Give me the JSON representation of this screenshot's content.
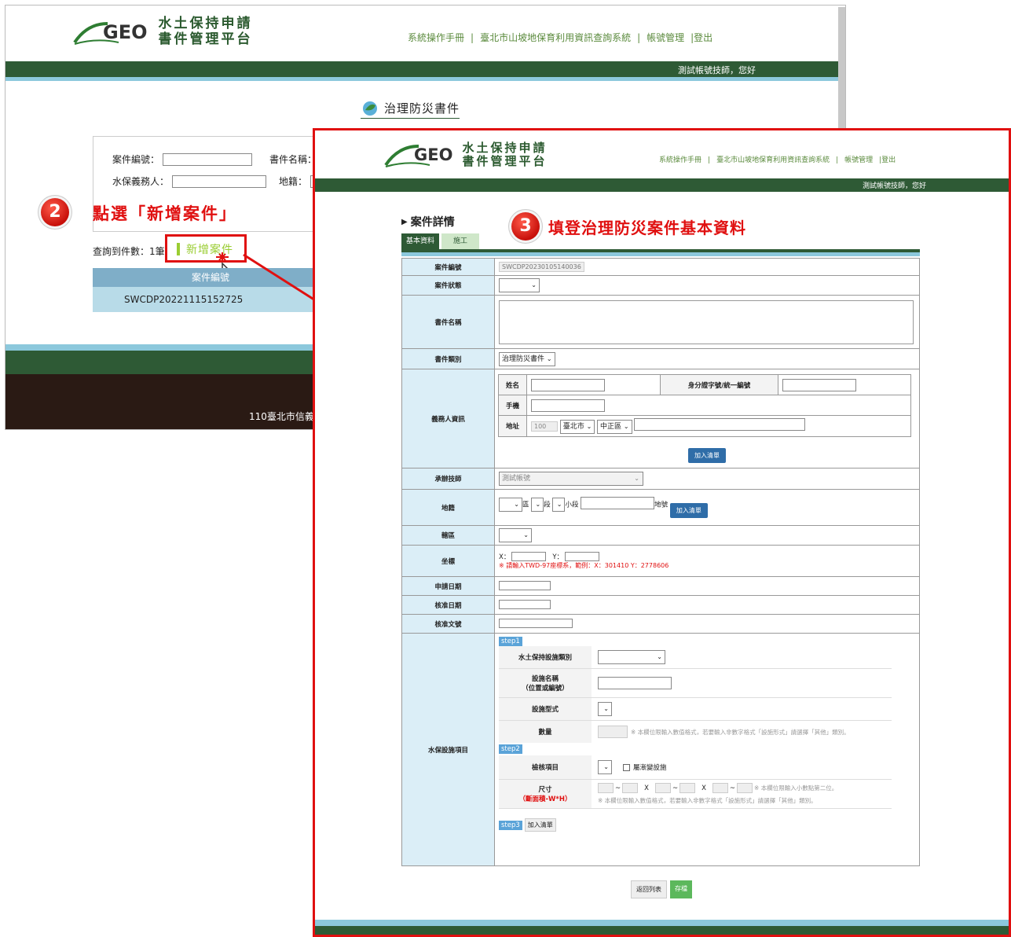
{
  "bg": {
    "logo_geo": "GEO",
    "logo_line1": "水土保持申請",
    "logo_line2": "書件管理平台",
    "nav": [
      "系統操作手冊",
      "|",
      "臺北市山坡地保育利用資訊查詢系統",
      "|",
      "帳號管理",
      "|登出"
    ],
    "greeting": "測試帳號技師，您好",
    "page_title": "治理防災書件",
    "search": {
      "case_no_label": "案件編號：",
      "doc_name_label": "書件名稱：",
      "obligor_label": "水保義務人：",
      "land_label": "地籍："
    },
    "result_count": "查詢到件數：1筆",
    "add_case": "新增案件",
    "table_header": "案件編號",
    "table_row": "SWCDP20221115152725",
    "footer_addr": "110臺北市信義"
  },
  "annotations": {
    "step2_num": "2",
    "step2_text": "點選「新增案件」",
    "step3_num": "3",
    "step3_text": "填登治理防災案件基本資料"
  },
  "fg": {
    "logo_geo": "GEO",
    "logo_line1": "水土保持申請",
    "logo_line2": "書件管理平台",
    "nav": [
      "系統操作手冊",
      "|",
      "臺北市山坡地保育利用資訊查詢系統",
      "|",
      "帳號管理",
      "|登出"
    ],
    "greeting": "測試帳號技師，您好",
    "section_title": "案件詳情",
    "tabs": [
      "基本資料",
      "施工"
    ],
    "rows": {
      "case_no_label": "案件編號",
      "case_no_value": "SWCDP20230105140036",
      "status_label": "案件狀態",
      "doc_name_label": "書件名稱",
      "doc_type_label": "書件類別",
      "doc_type_value": "治理防災書件",
      "obligor_label": "義務人資訊",
      "name_label": "姓名",
      "id_label": "身分證字號/統一編號",
      "phone_label": "手機",
      "addr_label": "地址",
      "zip_value": "100",
      "city_value": "臺北市",
      "district_value": "中正區",
      "add_list_btn": "加入清單",
      "engineer_label": "承辦技師",
      "engineer_value": "測試帳號",
      "land_label": "地籍",
      "land_qu": "區",
      "land_duan": "段",
      "land_xiaoduan": "小段",
      "land_dihao": "地號",
      "land_add_btn": "加入清單",
      "district2_label": "轄區",
      "coord_label": "坐標",
      "coord_x": "X：",
      "coord_y": "Y：",
      "coord_note": "※ 請輸入TWD-97座標系，範例：X：301410 Y：2778606",
      "apply_date_label": "申請日期",
      "approve_date_label": "核准日期",
      "approve_no_label": "核准文號",
      "facility_label": "水保設施項目",
      "step1": "step1",
      "fac_type_label": "水土保持設施類別",
      "fac_name_label1": "設施名稱",
      "fac_name_label2": "（位置或編號）",
      "fac_form_label": "設施型式",
      "qty_label": "數量",
      "qty_note": "※ 本欄位限輸入數值格式，若要輸入非數字格式「設施形式」請選擇「其他」類別。",
      "step2": "step2",
      "check_label": "檢核項目",
      "gradual_label": "屬漸變設施",
      "size_label": "尺寸",
      "size_sub": "（斷面積-W*H）",
      "size_note1": "※ 本欄位限輸入小數點第二位。",
      "size_note2": "※ 本欄位限輸入數值格式，若要輸入非數字格式「設施形式」請選擇「其他」類別。",
      "step3": "step3",
      "step3_btn": "加入清單"
    },
    "back_btn": "返回列表",
    "save_btn": "存檔"
  }
}
